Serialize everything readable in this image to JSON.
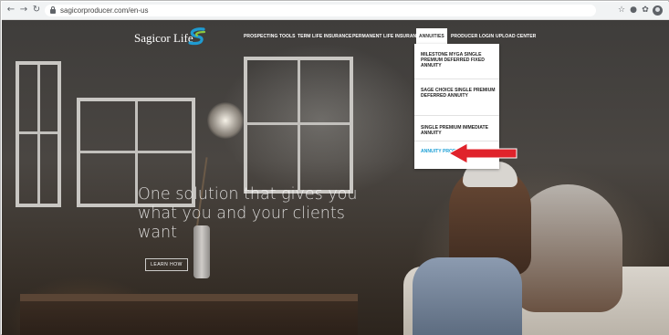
{
  "browser": {
    "url": "sagicorproducer.com/en-us",
    "icons": {
      "back": "arrow-left-icon",
      "forward": "arrow-right-icon",
      "reload": "reload-icon",
      "lock": "lock-icon",
      "star": "star-icon",
      "extension_1": "record-icon",
      "extension_2": "puzzle-icon",
      "profile": "profile-avatar-icon"
    }
  },
  "site": {
    "logo_text": "Sagicor Life",
    "brand_colors": {
      "teal": "#1f9bd1",
      "green": "#8cc63f",
      "accent_link": "#1ea0d6"
    },
    "nav": [
      {
        "label": "PROSPECTING TOOLS"
      },
      {
        "label": "TERM LIFE INSURANCE"
      },
      {
        "label": "PERMANENT LIFE INSURANCE"
      },
      {
        "label": "ANNUITIES",
        "active": true
      },
      {
        "label": "PRODUCER LOGIN"
      },
      {
        "label": "UPLOAD CENTER"
      }
    ],
    "dropdown": {
      "items": [
        {
          "label": "MILESTONE MYGA SINGLE PREMIUM DEFERRED FIXED ANNUITY"
        },
        {
          "label": "SAGE CHOICE SINGLE PREMIUM DEFERRED ANNUITY"
        },
        {
          "label": "SINGLE PREMIUM IMMEDIATE ANNUITY"
        },
        {
          "label": "ANNUITY PRODUCT TRAINING",
          "highlighted": true
        }
      ]
    },
    "annotation": {
      "icon": "red-arrow-icon",
      "color": "#e0232b"
    },
    "hero": {
      "lines": [
        "One solution that gives you",
        "what you and your clients",
        "want"
      ],
      "cta_label": "LEARN HOW"
    }
  }
}
